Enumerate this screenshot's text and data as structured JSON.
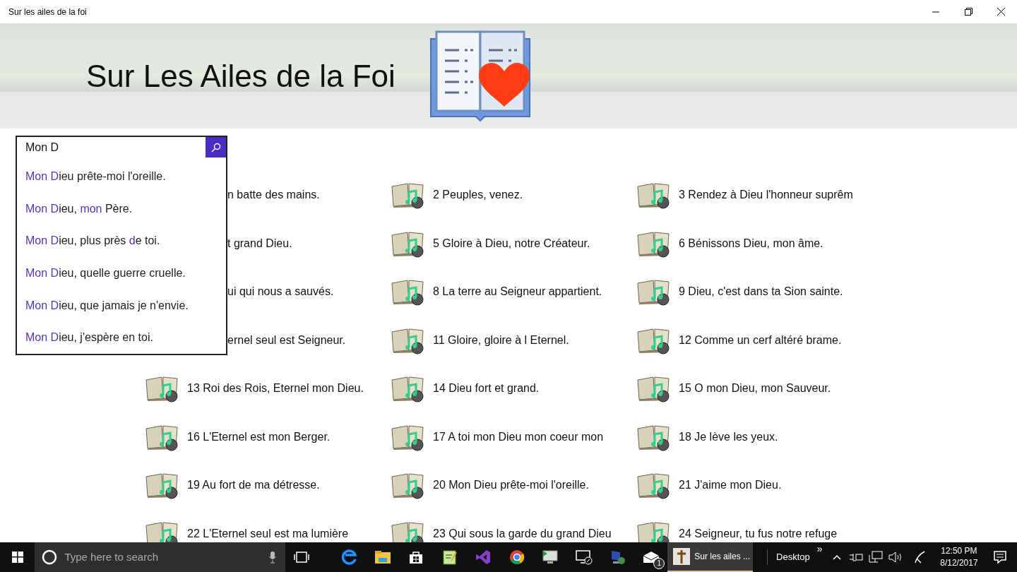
{
  "window": {
    "title": "Sur les ailes de la foi"
  },
  "header": {
    "title": "Sur Les Ailes de la Foi"
  },
  "search": {
    "value": "Mon D",
    "suggestions": [
      [
        {
          "text": "Mon D",
          "match": true
        },
        {
          "text": "ieu prête-moi l'oreille.",
          "match": false
        }
      ],
      [
        {
          "text": "Mon D",
          "match": true
        },
        {
          "text": "ieu, ",
          "match": false
        },
        {
          "text": "mon",
          "match": true
        },
        {
          "text": " Père.",
          "match": false
        }
      ],
      [
        {
          "text": "Mon D",
          "match": true
        },
        {
          "text": "ieu, plus près ",
          "match": false
        },
        {
          "text": "d",
          "match": true
        },
        {
          "text": "e toi.",
          "match": false
        }
      ],
      [
        {
          "text": "Mon D",
          "match": true
        },
        {
          "text": "ieu, quelle guerre cruelle.",
          "match": false
        }
      ],
      [
        {
          "text": "Mon D",
          "match": true
        },
        {
          "text": "ieu, que jamais je n'envie.",
          "match": false
        }
      ],
      [
        {
          "text": "Mon D",
          "match": true
        },
        {
          "text": "ieu, j'espère en toi.",
          "match": false
        }
      ]
    ]
  },
  "songs": [
    {
      "title": "n batte des mains.",
      "covered": true
    },
    {
      "title": "2 Peuples, venez.",
      "covered": false
    },
    {
      "title": "3 Rendez à Dieu l'honneur suprêm",
      "covered": false
    },
    {
      "title": "t grand Dieu.",
      "covered": true
    },
    {
      "title": "5 Gloire à Dieu, notre Créateur.",
      "covered": false
    },
    {
      "title": "6 Bénissons Dieu, mon âme.",
      "covered": false
    },
    {
      "title": "ui qui nous a sauvés.",
      "covered": true
    },
    {
      "title": "8 La terre au Seigneur appartient.",
      "covered": false
    },
    {
      "title": "9 Dieu, c'est dans ta Sion sainte.",
      "covered": false
    },
    {
      "title": "ernel seul est Seigneur.",
      "covered": true
    },
    {
      "title": "11 Gloire, gloire à l Eternel.",
      "covered": false
    },
    {
      "title": "12 Comme un cerf altéré brame.",
      "covered": false
    },
    {
      "title": "13 Roi des Rois, Eternel mon Dieu.",
      "covered": false
    },
    {
      "title": "14 Dieu fort et grand.",
      "covered": false
    },
    {
      "title": "15 O mon Dieu, mon Sauveur.",
      "covered": false
    },
    {
      "title": "16 L'Eternel est mon Berger.",
      "covered": false
    },
    {
      "title": "17 A toi mon Dieu mon coeur mon",
      "covered": false
    },
    {
      "title": "18 Je lève les yeux.",
      "covered": false
    },
    {
      "title": "19 Au fort de ma détresse.",
      "covered": false
    },
    {
      "title": "20 Mon Dieu prête-moi l'oreille.",
      "covered": false
    },
    {
      "title": "21 J'aime mon Dieu.",
      "covered": false
    },
    {
      "title": "22 L'Eternel seul est ma lumière",
      "covered": false
    },
    {
      "title": "23 Qui sous la garde du grand Dieu",
      "covered": false
    },
    {
      "title": "24 Seigneur, tu fus notre refuge",
      "covered": false
    }
  ],
  "taskbar": {
    "search_placeholder": "Type here to search",
    "active_app": "Sur les ailes ...",
    "mail_badge": "1",
    "desktop": "Desktop",
    "overflow": "»",
    "time": "12:50 PM",
    "date": "8/12/2017"
  }
}
